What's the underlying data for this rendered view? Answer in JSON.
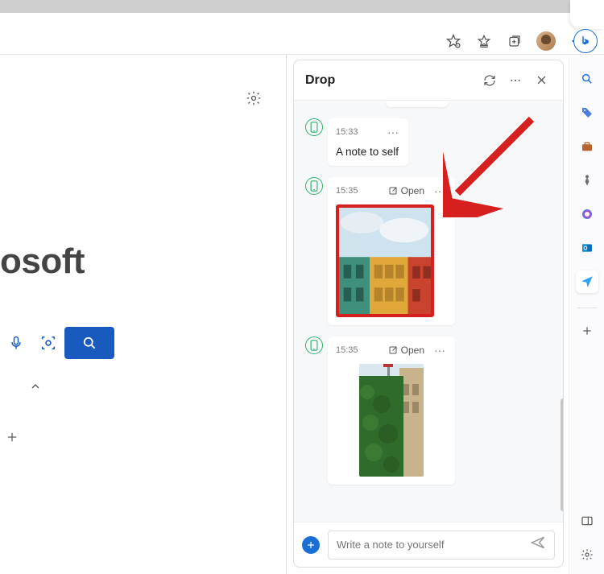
{
  "toolbar": {
    "star_icon": "favorite-star",
    "favorites_icon": "favorites",
    "collections_icon": "collections",
    "avatar": "user-avatar",
    "more_icon": "more",
    "bing_icon": "bing"
  },
  "main": {
    "logo_fragment": "osoft",
    "settings_icon": "settings",
    "mic_icon": "microphone",
    "camera_icon": "visual-search",
    "search_go_icon": "search",
    "chevron_icon": "chevron-up",
    "plus_icon": "add"
  },
  "drop": {
    "title": "Drop",
    "refresh_icon": "refresh",
    "more_icon": "more",
    "close_icon": "close",
    "messages": [
      {
        "time": "15:33",
        "more": "···",
        "body": "A note to self",
        "type": "note"
      },
      {
        "time": "15:35",
        "open_label": "Open",
        "more": "···",
        "type": "image",
        "highlighted": true,
        "image_desc": "colorful-shophouses-photo"
      },
      {
        "time": "15:35",
        "open_label": "Open",
        "more": "···",
        "type": "image",
        "highlighted": false,
        "image_desc": "green-wall-building-photo"
      }
    ],
    "composer": {
      "add_icon": "add",
      "placeholder": "Write a note to yourself",
      "send_icon": "send"
    }
  },
  "vbar": {
    "items": [
      {
        "name": "search",
        "color": "#1a6fd6"
      },
      {
        "name": "shopping-tag",
        "color": "#3d7bd9"
      },
      {
        "name": "briefcase",
        "color": "#c4643a"
      },
      {
        "name": "games",
        "color": "#6b6b6b"
      },
      {
        "name": "office",
        "color": "#d83b01"
      },
      {
        "name": "outlook",
        "color": "#0f6cbd"
      },
      {
        "name": "drop",
        "color": "#1a6fd6",
        "active": true
      },
      {
        "name": "add-tool",
        "color": "#555"
      }
    ],
    "bottom": [
      {
        "name": "split-screen",
        "color": "#555"
      },
      {
        "name": "settings",
        "color": "#555"
      }
    ]
  },
  "annotation": {
    "arrow_points_to": "second-message-image"
  }
}
